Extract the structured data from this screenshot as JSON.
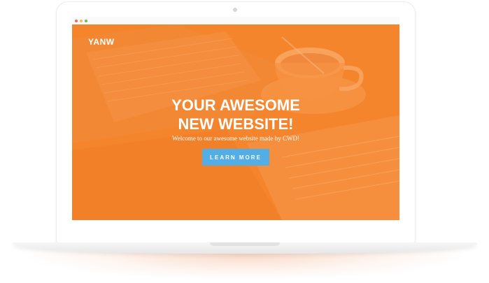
{
  "site": {
    "brand": "YANW",
    "headline_line1": "YOUR AWESOME",
    "headline_line2": "NEW WEBSITE!",
    "tagline": "Welcome to our awesome website made by CWD!",
    "cta_label": "LEARN MORE"
  },
  "colors": {
    "hero_overlay": "#f4852d",
    "cta_background": "#53aee6",
    "text": "#ffffff",
    "window_dot_close": "#f26b5b",
    "window_dot_minimize": "#f6be4f",
    "window_dot_maximize": "#5fc455"
  },
  "icons": {
    "window_controls": [
      "close-dot-icon",
      "minimize-dot-icon",
      "maximize-dot-icon"
    ],
    "camera": "webcam-icon"
  }
}
